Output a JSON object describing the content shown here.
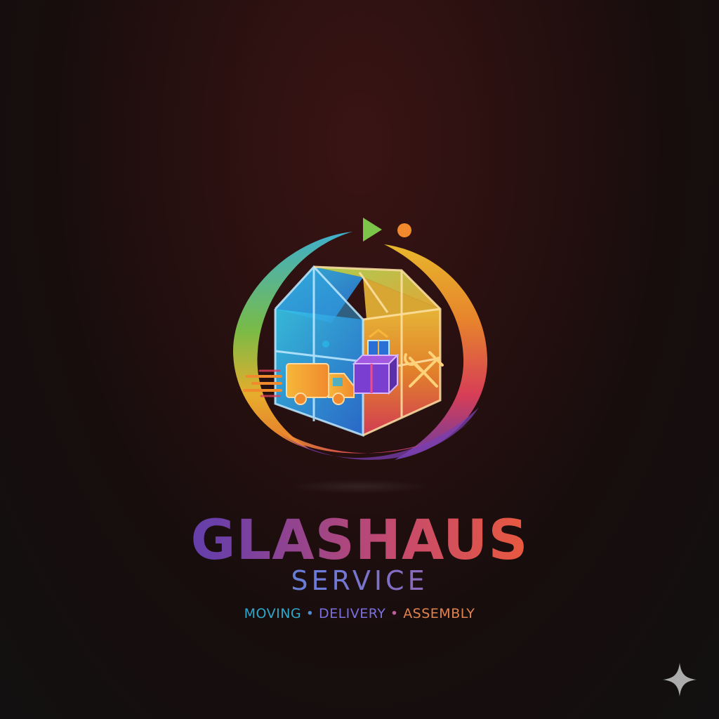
{
  "brand": {
    "name": "GLASHAUS",
    "subtitle": "SERVICE",
    "tagline": {
      "moving": "MOVING",
      "delivery": "DELIVERY",
      "assembly": "ASSEMBLY",
      "separator": "•"
    }
  },
  "icons": {
    "logo_emblem": "glass-house-emblem-icon",
    "truck": "delivery-truck-icon",
    "boxes": "gift-boxes-icon",
    "tools": "wrench-hammer-icon",
    "play": "play-arrow-icon",
    "dot": "orange-dot-icon",
    "sparkle": "sparkle-icon"
  },
  "colors": {
    "background": "#1a0f0f",
    "blue": "#2f8fe0",
    "orange": "#f18a2d",
    "purple": "#7a3fb0",
    "pink": "#e04a6a",
    "green": "#7dc44a"
  }
}
